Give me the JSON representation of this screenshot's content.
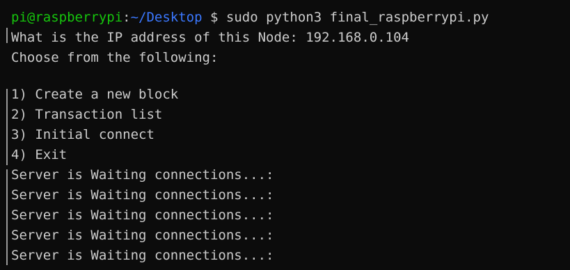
{
  "terminal": {
    "prompt": {
      "user_host": "pi@raspberrypi",
      "separator": ":",
      "path": "~/Desktop",
      "symbol": "$",
      "command": "sudo python3 final_raspberrypi.py"
    },
    "lines": [
      "What is the IP address of this Node: 192.168.0.104",
      "Choose from the following:",
      "",
      "1) Create a new block",
      "2) Transaction list",
      "3) Initial connect",
      "4) Exit",
      "Server is Waiting connections...:",
      "Server is Waiting connections...:",
      "Server is Waiting connections...:",
      "Server is Waiting connections...:",
      "Server is Waiting connections...:"
    ],
    "colors": {
      "background": "#0c0c0c",
      "text": "#cccccc",
      "user_host": "#16c60c",
      "path": "#3b78ff"
    }
  }
}
